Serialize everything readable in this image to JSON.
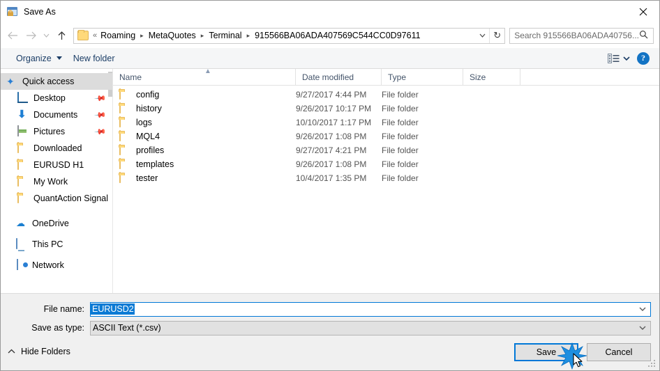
{
  "window": {
    "title": "Save As",
    "title_icon": "save-as-window-icon",
    "close_icon": "close-icon"
  },
  "nav": {
    "back_icon": "back-arrow-icon",
    "forward_icon": "forward-arrow-icon",
    "recent_icon": "chevron-down-icon",
    "up_icon": "up-arrow-icon",
    "folder_icon": "folder-icon",
    "breadcrumbs": [
      "Roaming",
      "MetaQuotes",
      "Terminal",
      "915566BA06ADA407569C544CC0D97611"
    ],
    "breadcrumb_prefix": "«",
    "dropdown_icon": "chevron-down-icon",
    "refresh_icon": "refresh-icon",
    "refresh_glyph": "↻"
  },
  "search": {
    "placeholder": "Search 915566BA06ADA40756...",
    "icon": "search-icon"
  },
  "toolbar": {
    "organize_label": "Organize",
    "new_folder_label": "New folder",
    "view_icon": "view-layout-icon",
    "view_caret_icon": "chevron-down-icon",
    "help_label": "?",
    "help_icon": "help-icon"
  },
  "sidebar": {
    "scrollbar": "vertical-scrollbar",
    "groups": [
      {
        "header": {
          "label": "Quick access",
          "icon": "pin-star-icon",
          "selected": true
        },
        "items": [
          {
            "label": "Desktop",
            "icon": "desktop-icon",
            "pinned": true
          },
          {
            "label": "Documents",
            "icon": "documents-icon",
            "pinned": true
          },
          {
            "label": "Pictures",
            "icon": "pictures-icon",
            "pinned": true
          },
          {
            "label": "Downloaded",
            "icon": "folder-icon",
            "pinned": false
          },
          {
            "label": "EURUSD H1",
            "icon": "folder-icon",
            "pinned": false
          },
          {
            "label": "My Work",
            "icon": "folder-icon",
            "pinned": false
          },
          {
            "label": "QuantAction Signal",
            "icon": "folder-icon",
            "pinned": false
          }
        ]
      }
    ],
    "roots": [
      {
        "label": "OneDrive",
        "icon": "onedrive-icon"
      },
      {
        "label": "This PC",
        "icon": "this-pc-icon"
      },
      {
        "label": "Network",
        "icon": "network-icon"
      }
    ]
  },
  "filelist": {
    "columns": [
      "Name",
      "Date modified",
      "Type",
      "Size"
    ],
    "sort_column": "Name",
    "sort_direction": "ascending",
    "sort_icon": "caret-up-icon",
    "rows": [
      {
        "name": "config",
        "date": "9/27/2017 4:44 PM",
        "type": "File folder",
        "size": "",
        "icon": "folder-icon"
      },
      {
        "name": "history",
        "date": "9/26/2017 10:17 PM",
        "type": "File folder",
        "size": "",
        "icon": "folder-icon"
      },
      {
        "name": "logs",
        "date": "10/10/2017 1:17 PM",
        "type": "File folder",
        "size": "",
        "icon": "folder-icon"
      },
      {
        "name": "MQL4",
        "date": "9/26/2017 1:08 PM",
        "type": "File folder",
        "size": "",
        "icon": "folder-icon"
      },
      {
        "name": "profiles",
        "date": "9/27/2017 4:21 PM",
        "type": "File folder",
        "size": "",
        "icon": "folder-icon"
      },
      {
        "name": "templates",
        "date": "9/26/2017 1:08 PM",
        "type": "File folder",
        "size": "",
        "icon": "folder-icon"
      },
      {
        "name": "tester",
        "date": "10/4/2017 1:35 PM",
        "type": "File folder",
        "size": "",
        "icon": "folder-icon"
      }
    ]
  },
  "form": {
    "filename_label": "File name:",
    "filename_value": "EURUSD2",
    "filename_selected": true,
    "filetype_label": "Save as type:",
    "filetype_value": "ASCII Text (*.csv)",
    "dropdown_icon": "chevron-down-icon"
  },
  "footer": {
    "hide_folders_label": "Hide Folders",
    "hide_folders_icon": "caret-up-icon",
    "save_label": "Save",
    "cancel_label": "Cancel",
    "resize_grip_icon": "resize-grip-icon",
    "cursor_icon": "mouse-pointer-icon",
    "click_burst_icon": "click-burst-icon"
  },
  "colors": {
    "accent": "#0078d7",
    "selection": "#0b7ad4",
    "folder_yellow": "#ffd97a",
    "header_text": "#44546a",
    "toolbar_text": "#1b3d66",
    "help_blue": "#1373c4"
  }
}
